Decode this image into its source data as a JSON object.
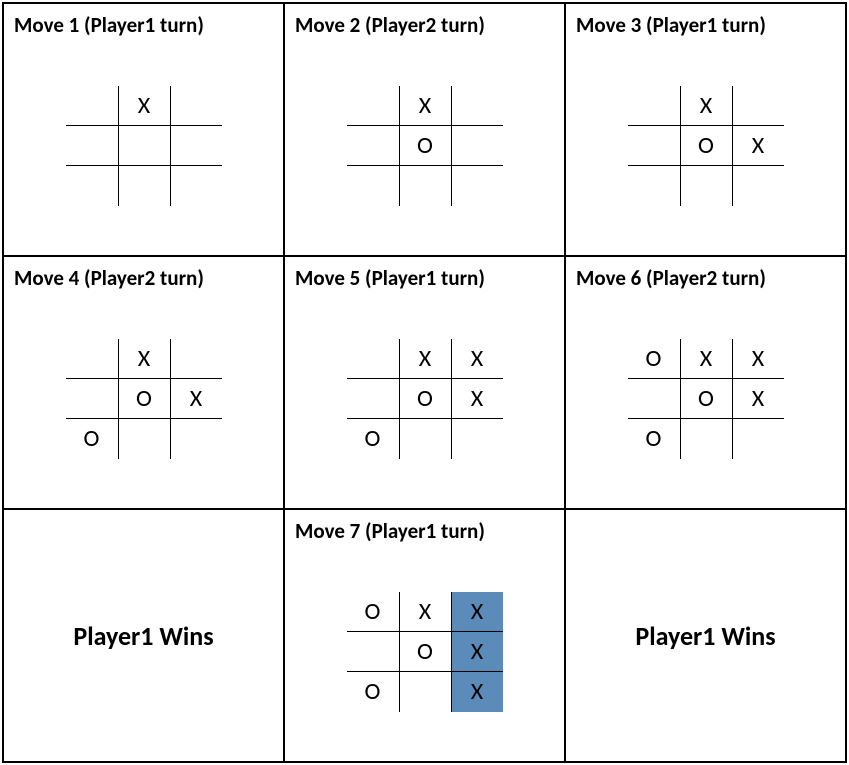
{
  "panels": [
    {
      "title": "Move 1 (Player1 turn)",
      "board": [
        [
          "",
          "X",
          ""
        ],
        [
          "",
          "",
          ""
        ],
        [
          "",
          "",
          ""
        ]
      ],
      "highlight": []
    },
    {
      "title": "Move 2 (Player2 turn)",
      "board": [
        [
          "",
          "X",
          ""
        ],
        [
          "",
          "O",
          ""
        ],
        [
          "",
          "",
          ""
        ]
      ],
      "highlight": []
    },
    {
      "title": "Move 3 (Player1 turn)",
      "board": [
        [
          "",
          "X",
          ""
        ],
        [
          "",
          "O",
          "X"
        ],
        [
          "",
          "",
          ""
        ]
      ],
      "highlight": []
    },
    {
      "title": "Move 4 (Player2 turn)",
      "board": [
        [
          "",
          "X",
          ""
        ],
        [
          "",
          "O",
          "X"
        ],
        [
          "O",
          "",
          ""
        ]
      ],
      "highlight": []
    },
    {
      "title": "Move 5 (Player1 turn)",
      "board": [
        [
          "",
          "X",
          "X"
        ],
        [
          "",
          "O",
          "X"
        ],
        [
          "O",
          "",
          ""
        ]
      ],
      "highlight": []
    },
    {
      "title": "Move 6 (Player2 turn)",
      "board": [
        [
          "O",
          "X",
          "X"
        ],
        [
          "",
          "O",
          "X"
        ],
        [
          "O",
          "",
          ""
        ]
      ],
      "highlight": []
    },
    {
      "title": "Player1 Wins",
      "wins": true
    },
    {
      "title": "Move 7 (Player1 turn)",
      "board": [
        [
          "O",
          "X",
          "X"
        ],
        [
          "",
          "O",
          "X"
        ],
        [
          "O",
          "",
          "X"
        ]
      ],
      "highlight": [
        [
          0,
          2
        ],
        [
          1,
          2
        ],
        [
          2,
          2
        ]
      ]
    },
    {
      "title": "Player1 Wins",
      "wins": true
    }
  ]
}
